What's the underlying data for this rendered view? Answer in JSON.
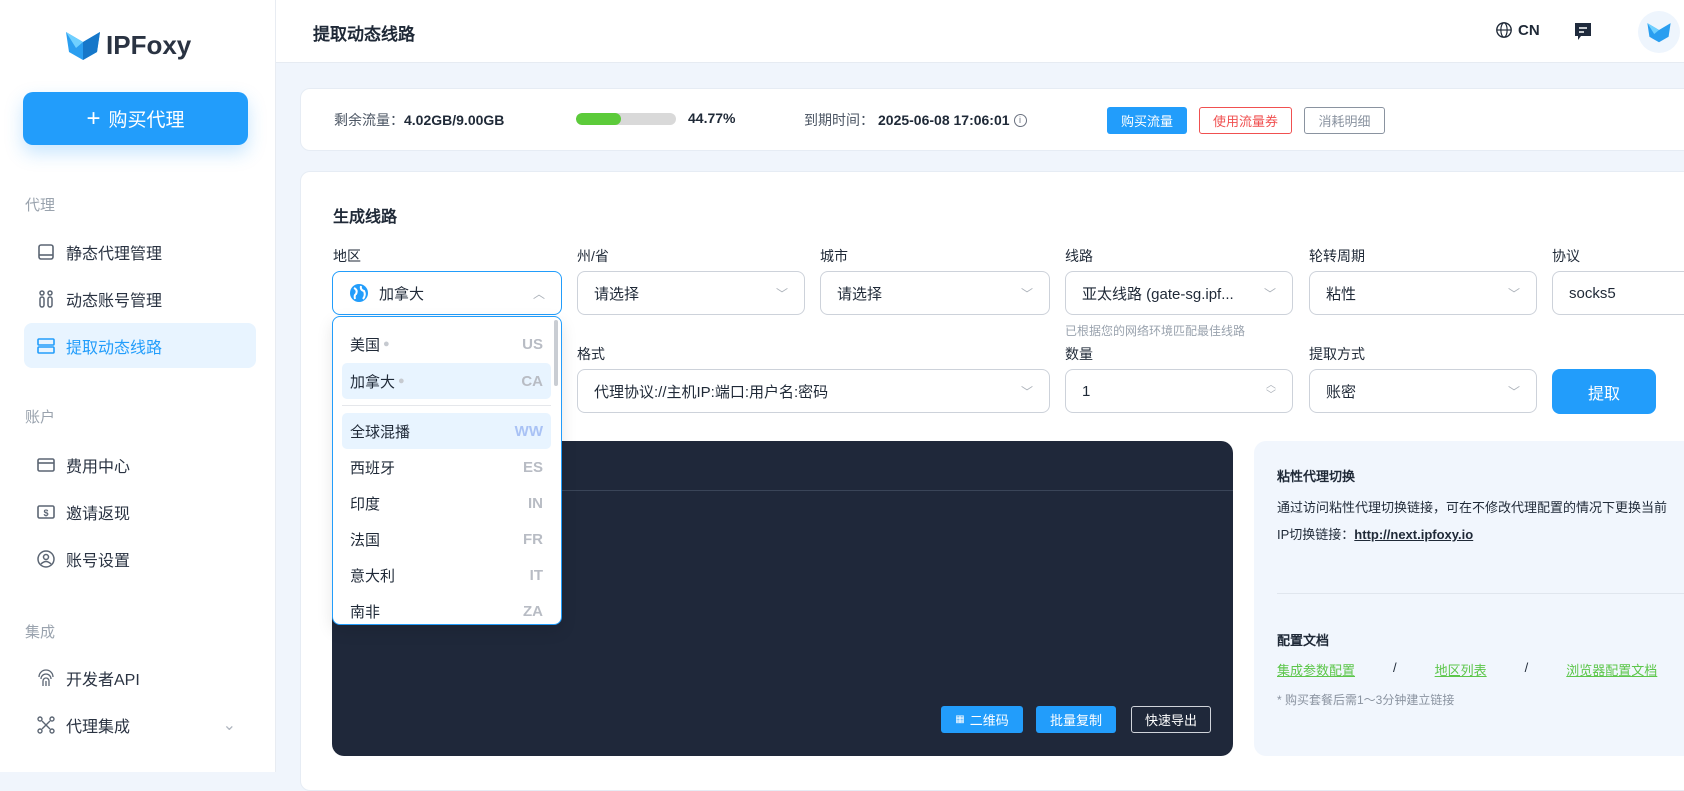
{
  "brand": {
    "name": "IPFoxy"
  },
  "sidebar": {
    "buy_label": "购买代理",
    "sections": [
      {
        "title": "代理",
        "items": [
          {
            "label": "静态代理管理",
            "icon": "device-icon"
          },
          {
            "label": "动态账号管理",
            "icon": "accounts-icon"
          },
          {
            "label": "提取动态线路",
            "icon": "server-icon",
            "active": true
          }
        ]
      },
      {
        "title": "账户",
        "items": [
          {
            "label": "费用中心",
            "icon": "card-icon"
          },
          {
            "label": "邀请返现",
            "icon": "dollar-icon"
          },
          {
            "label": "账号设置",
            "icon": "user-icon"
          }
        ]
      },
      {
        "title": "集成",
        "items": [
          {
            "label": "开发者API",
            "icon": "fingerprint-icon"
          },
          {
            "label": "代理集成",
            "icon": "integration-icon"
          }
        ]
      }
    ]
  },
  "header": {
    "title": "提取动态线路",
    "lang": "CN"
  },
  "usage": {
    "remaining_label": "剩余流量：",
    "remaining_value": "4.02GB/9.00GB",
    "percent_text": "44.77%",
    "percent": 44.77,
    "expire_label": "到期时间：",
    "expire_value": "2025-06-08 17:06:01",
    "buy_traffic": "购买流量",
    "use_coupon": "使用流量券",
    "details": "消耗明细"
  },
  "form": {
    "title": "生成线路",
    "region": {
      "label": "地区",
      "value": "加拿大"
    },
    "state": {
      "label": "州/省",
      "value": "请选择"
    },
    "city": {
      "label": "城市",
      "value": "请选择"
    },
    "route": {
      "label": "线路",
      "value": "亚太线路 (gate-sg.ipf...",
      "hint": "已根据您的网络环境匹配最佳线路"
    },
    "rotation": {
      "label": "轮转周期",
      "value": "粘性"
    },
    "protocol": {
      "label": "协议",
      "value": "socks5"
    },
    "format": {
      "label": "格式",
      "value": "代理协议://主机IP:端口:用户名:密码"
    },
    "quantity": {
      "label": "数量",
      "value": "1"
    },
    "method": {
      "label": "提取方式",
      "value": "账密"
    },
    "extract": "提取"
  },
  "dropdown": {
    "hot": [
      {
        "name": "美国",
        "code": "US"
      },
      {
        "name": "加拿大",
        "code": "CA"
      }
    ],
    "items": [
      {
        "name": "全球混播",
        "code": "WW"
      },
      {
        "name": "西班牙",
        "code": "ES"
      },
      {
        "name": "印度",
        "code": "IN"
      },
      {
        "name": "法国",
        "code": "FR"
      },
      {
        "name": "意大利",
        "code": "IT"
      },
      {
        "name": "南非",
        "code": "ZA"
      }
    ]
  },
  "output": {
    "qr": "二维码",
    "batch_copy": "批量复制",
    "export": "快速导出"
  },
  "info": {
    "sticky_title": "粘性代理切换",
    "sticky_desc": "通过访问粘性代理切换链接，可在不修改代理配置的情况下更换当前",
    "ip_link_label": "IP切换链接：",
    "ip_link": "http://next.ipfoxy.io",
    "docs_title": "配置文档",
    "doc1": "集成参数配置",
    "doc2": "地区列表",
    "doc3": "浏览器配置文档",
    "sep": "/",
    "note": "* 购买套餐后需1～3分钟建立链接"
  },
  "colors": {
    "accent": "#229dfb",
    "progress": "#5ccb3a",
    "danger": "#f05050",
    "dark_panel": "#1f283a"
  }
}
